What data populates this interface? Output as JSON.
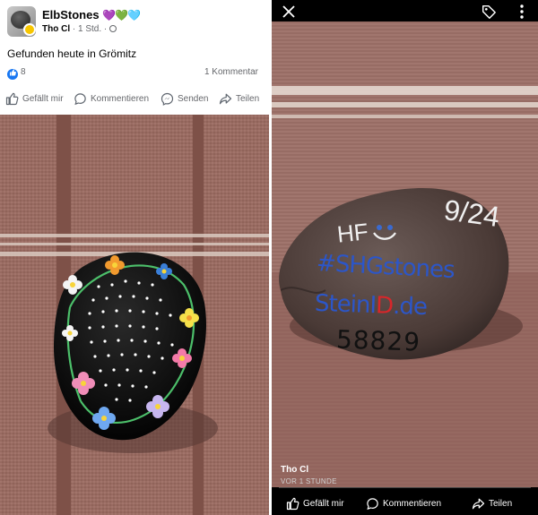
{
  "left_post": {
    "group_name": "ElbStones",
    "hearts": "💜💚🩵",
    "author": "Tho Cl",
    "time": "1 Std.",
    "text": "Gefunden heute in Grömitz",
    "reaction_count": "8",
    "comment_count_label": "1 Kommentar",
    "actions": {
      "like": "Gefällt mir",
      "comment": "Kommentieren",
      "send": "Senden",
      "share": "Teilen"
    }
  },
  "right_view": {
    "author": "Tho Cl",
    "time_label": "VOR 1 STUNDE",
    "actions": {
      "like": "Gefällt mir",
      "comment": "Kommentieren",
      "share": "Teilen"
    },
    "stone_text": {
      "line1_left": "HF",
      "line1_right": "9/24",
      "line2": "#SHGstones",
      "line3a": "SteinI",
      "line3b": "D",
      "line3c": ".de",
      "line4": "58829"
    }
  },
  "colors": {
    "like_blue": "#1877f2",
    "meta_gray": "#65676b",
    "stone_blue": "#2c56c8",
    "stone_red": "#d8262a"
  },
  "icons": [
    "more-dots-icon",
    "close-icon",
    "tag-icon",
    "like-icon",
    "comment-icon",
    "messenger-icon",
    "share-icon",
    "globe-icon"
  ]
}
